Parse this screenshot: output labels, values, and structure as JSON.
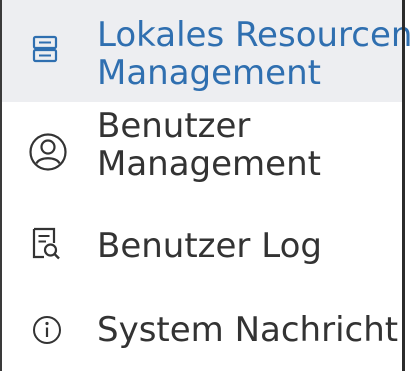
{
  "menu": {
    "items": [
      {
        "line1": "Lokales Resourcen",
        "line2": "Management",
        "icon": "server-icon",
        "active": true
      },
      {
        "line1": "Benutzer",
        "line2": "Management",
        "icon": "user-icon",
        "active": false
      },
      {
        "line1": "Benutzer Log",
        "icon": "log-search-icon",
        "active": false
      },
      {
        "line1": "System Nachricht",
        "icon": "info-icon",
        "active": false
      }
    ]
  },
  "colors": {
    "active_background": "#edeef1",
    "active_text": "#2f6fb0",
    "text": "#333333",
    "border": "#2b2b2b"
  }
}
